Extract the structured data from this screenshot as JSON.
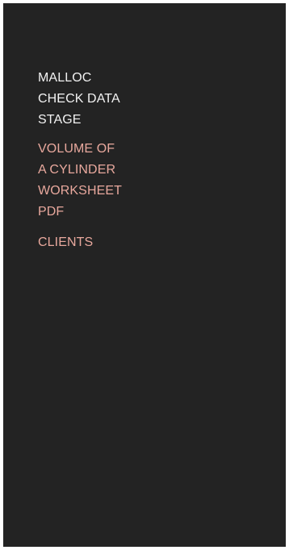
{
  "sidebar": {
    "title": "MALLOC\nCHECK DATA\nSTAGE",
    "links": [
      {
        "label": "VOLUME OF\nA CYLINDER\nWORKSHEET\nPDF"
      },
      {
        "label": "CLIENTS"
      }
    ]
  },
  "colors": {
    "panel_background": "#232323",
    "title_text": "#f2f2f2",
    "link_text": "#e8a89d"
  }
}
